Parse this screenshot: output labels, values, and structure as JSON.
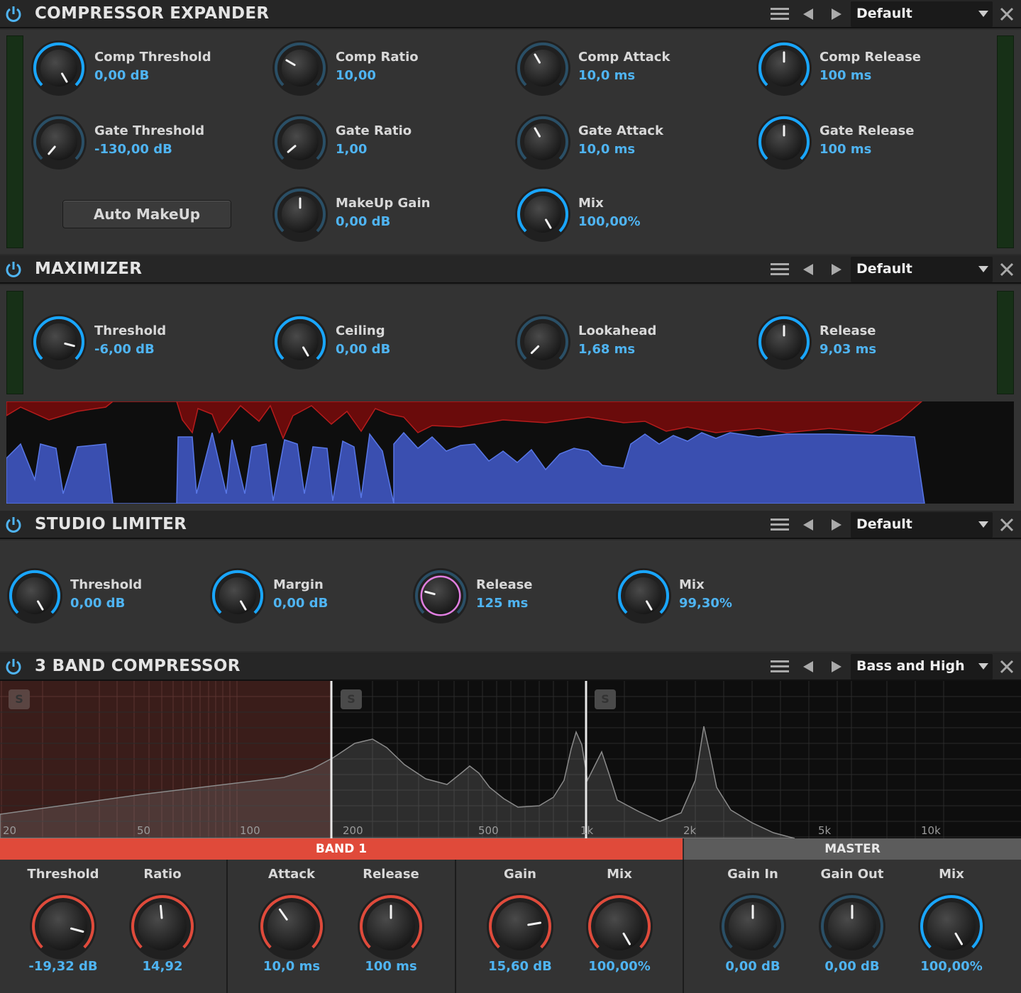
{
  "colors": {
    "accent_blue": "#19a6ff",
    "value_blue": "#4fb4f2",
    "band_red": "#e04a3a",
    "release_pink": "#e07ee0",
    "master_grey": "#5c5c5c"
  },
  "compressor_expander": {
    "title": "COMPRESSOR EXPANDER",
    "preset": "Default",
    "knobs": [
      {
        "label": "Comp Threshold",
        "value": "0,00 dB"
      },
      {
        "label": "Comp Ratio",
        "value": "10,00"
      },
      {
        "label": "Comp Attack",
        "value": "10,0 ms"
      },
      {
        "label": "Comp Release",
        "value": "100 ms"
      },
      {
        "label": "Gate Threshold",
        "value": "-130,00 dB"
      },
      {
        "label": "Gate Ratio",
        "value": "1,00"
      },
      {
        "label": "Gate Attack",
        "value": "10,0 ms"
      },
      {
        "label": "Gate Release",
        "value": "100 ms"
      },
      {
        "label": "MakeUp Gain",
        "value": "0,00 dB"
      },
      {
        "label": "Mix",
        "value": "100,00%"
      }
    ],
    "auto_makeup": "Auto MakeUp"
  },
  "maximizer": {
    "title": "MAXIMIZER",
    "preset": "Default",
    "knobs": [
      {
        "label": "Threshold",
        "value": "-6,00 dB"
      },
      {
        "label": "Ceiling",
        "value": "0,00 dB"
      },
      {
        "label": "Lookahead",
        "value": "1,68 ms"
      },
      {
        "label": "Release",
        "value": "9,03 ms"
      }
    ]
  },
  "studio_limiter": {
    "title": "STUDIO LIMITER",
    "preset": "Default",
    "knobs": [
      {
        "label": "Threshold",
        "value": "0,00 dB"
      },
      {
        "label": "Margin",
        "value": "0,00 dB"
      },
      {
        "label": "Release",
        "value": "125 ms"
      },
      {
        "label": "Mix",
        "value": "99,30%"
      }
    ]
  },
  "band_compressor": {
    "title": "3 BAND COMPRESSOR",
    "preset": "Bass and High",
    "freq_labels": [
      "20",
      "50",
      "100",
      "200",
      "500",
      "1k",
      "2k",
      "5k",
      "10k"
    ],
    "solo_label": "S",
    "band_tab": "BAND 1",
    "master_tab": "MASTER",
    "band_knobs": [
      {
        "label": "Threshold",
        "value": "-19,32 dB"
      },
      {
        "label": "Ratio",
        "value": "14,92"
      },
      {
        "label": "Attack",
        "value": "10,0 ms"
      },
      {
        "label": "Release",
        "value": "100 ms"
      },
      {
        "label": "Gain",
        "value": "15,60 dB"
      },
      {
        "label": "Mix",
        "value": "100,00%"
      }
    ],
    "master_knobs": [
      {
        "label": "Gain In",
        "value": "0,00 dB"
      },
      {
        "label": "Gain Out",
        "value": "0,00 dB"
      },
      {
        "label": "Mix",
        "value": "100,00%"
      }
    ]
  }
}
